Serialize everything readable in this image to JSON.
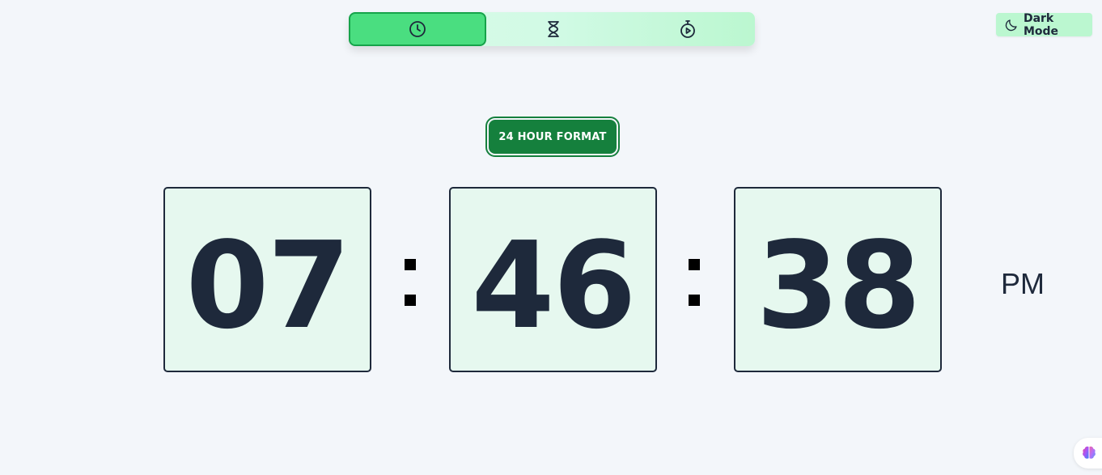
{
  "modes": [
    {
      "name": "clock",
      "icon": "clock-icon",
      "active": true
    },
    {
      "name": "timer",
      "icon": "hourglass-icon",
      "active": false
    },
    {
      "name": "stopwatch",
      "icon": "stopwatch-icon",
      "active": false
    }
  ],
  "theme_toggle": {
    "label": "Dark Mode",
    "icon": "moon-icon"
  },
  "format_button": {
    "label": "24 HOUR FORMAT"
  },
  "time": {
    "hours": "07",
    "minutes": "46",
    "seconds": "38",
    "separator": ":",
    "period": "PM"
  },
  "colors": {
    "accent": "#15803d",
    "active_tab": "#4ade80",
    "digit_bg": "#e6f8ef",
    "text": "#1e293b",
    "page_bg": "#f3f6fa"
  },
  "floating_badge": {
    "icon": "brain-icon"
  }
}
